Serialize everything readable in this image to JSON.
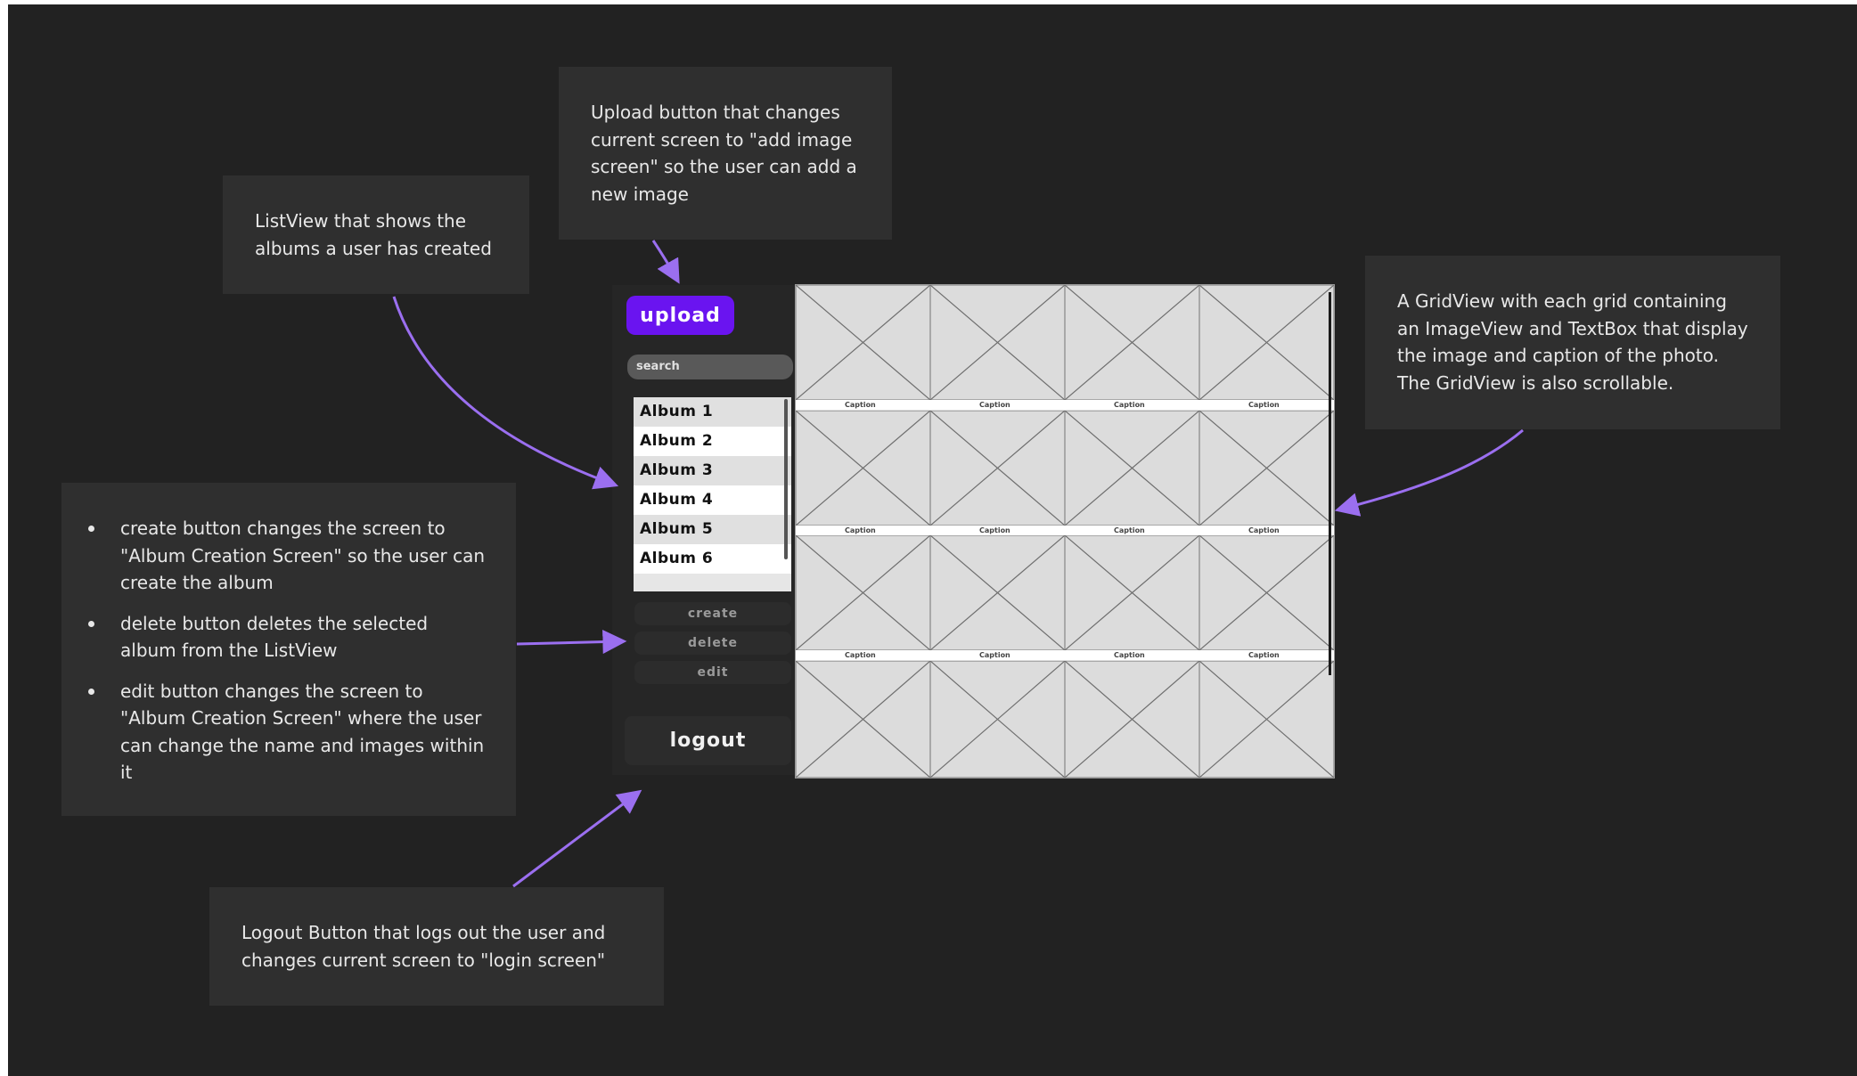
{
  "annotations": {
    "listview_note": "ListView that shows the albums a user has created",
    "upload_note": "Upload button that changes current screen to \"add image screen\" so the user can add a new image",
    "gridview_note": "A GridView with each grid containing an ImageView and TextBox that display the image and caption of the photo. The GridView is also scrollable.",
    "buttons_notes": [
      "create button changes the screen to \"Album Creation Screen\" so the user can create the album",
      "delete button deletes the selected album from the ListView",
      "edit button changes the screen to \"Album Creation Screen\" where the user can change the name and images within it"
    ],
    "logout_note": "Logout Button that logs out the user and changes current screen to \"login screen\""
  },
  "sidebar": {
    "upload_label": "upload",
    "search_placeholder": "search",
    "albums": [
      "Album 1",
      "Album 2",
      "Album 3",
      "Album 4",
      "Album 5",
      "Album 6"
    ],
    "create_label": "create",
    "delete_label": "delete",
    "edit_label": "edit",
    "logout_label": "logout"
  },
  "grid": {
    "caption_label": "Caption",
    "columns": 4,
    "rows": 4,
    "captioned_rows": 3
  },
  "colors": {
    "background": "#222222",
    "note_box": "#2f2f2f",
    "accent": "#6a14f0",
    "arrow": "#9b6ff0"
  }
}
